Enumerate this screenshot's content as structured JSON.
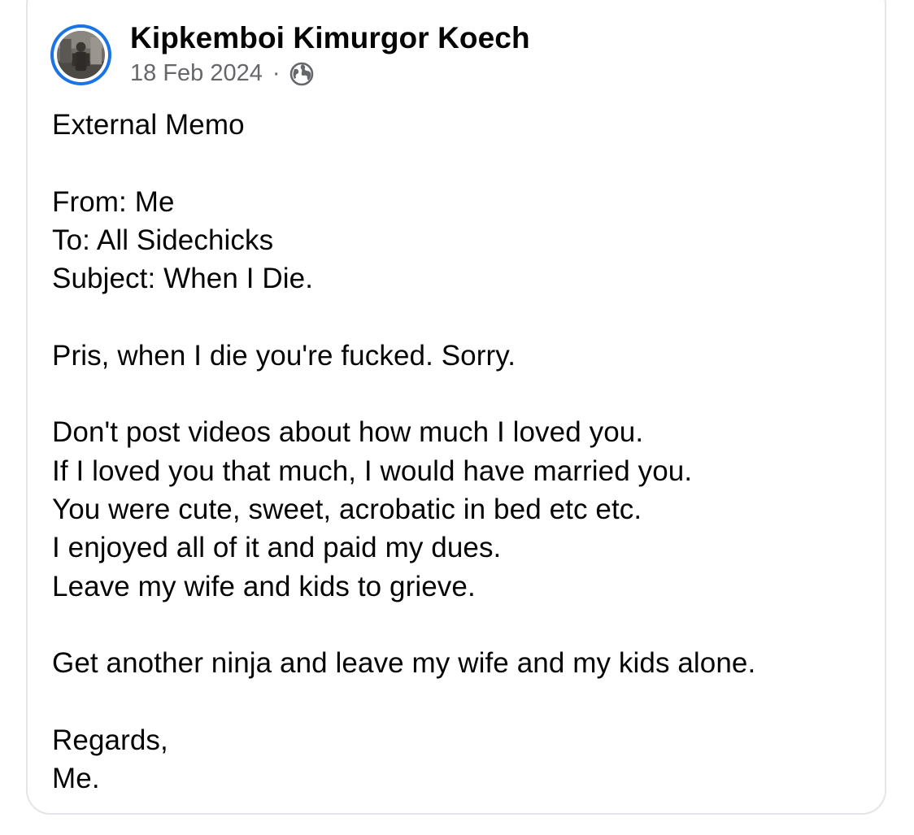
{
  "post": {
    "author": "Kipkemboi Kimurgor Koech",
    "date": "18 Feb 2024",
    "separator": "·",
    "privacy_icon": "globe-icon",
    "accent_color": "#1b74e4",
    "meta_color": "#65676b",
    "lines": [
      "External Memo",
      "",
      "From: Me",
      "To: All Sidechicks",
      "Subject: When I Die.",
      "",
      "Pris, when I die you're fucked. Sorry.",
      "",
      "Don't post videos about how much I loved you.",
      "If I loved you that much, I would have married you.",
      "You were cute, sweet, acrobatic in bed etc etc.",
      "I enjoyed all of it and paid my dues.",
      "Leave my wife and kids to grieve.",
      "",
      "Get another ninja and leave my wife and my kids alone.",
      "",
      "Regards,",
      "Me."
    ]
  }
}
